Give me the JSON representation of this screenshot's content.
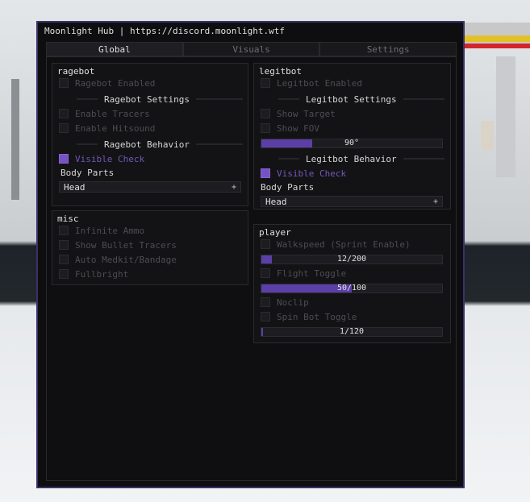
{
  "window": {
    "title": "Moonlight Hub | https://discord.moonlight.wtf"
  },
  "tabs": [
    "Global",
    "Visuals",
    "Settings"
  ],
  "ragebot": {
    "title": "ragebot",
    "enabled_label": "Ragebot Enabled",
    "settings_header": "Ragebot Settings",
    "tracers_label": "Enable Tracers",
    "hitsound_label": "Enable Hitsound",
    "behavior_header": "Ragebot Behavior",
    "visible_check_label": "Visible Check",
    "visible_check_checked": true,
    "body_parts_label": "Body Parts",
    "body_parts_value": "Head",
    "dropdown_icon": "+"
  },
  "misc": {
    "title": "misc",
    "items": [
      {
        "label": "Infinite Ammo",
        "checked": false
      },
      {
        "label": "Show Bullet Tracers",
        "checked": false
      },
      {
        "label": "Auto Medkit/Bandage",
        "checked": false
      },
      {
        "label": "Fullbright",
        "checked": false
      }
    ]
  },
  "legitbot": {
    "title": "legitbot",
    "enabled_label": "Legitbot Enabled",
    "settings_header": "Legitbot Settings",
    "show_target_label": "Show Target",
    "show_fov_label": "Show FOV",
    "fov_value": "90°",
    "fov_fraction": 0.28,
    "behavior_header": "Legitbot Behavior",
    "visible_check_label": "Visible Check",
    "visible_check_checked": true,
    "body_parts_label": "Body Parts",
    "body_parts_value": "Head",
    "dropdown_icon": "+"
  },
  "player": {
    "title": "player",
    "walkspeed_label": "Walkspeed (Sprint Enable)",
    "walkspeed_value": "12/200",
    "walkspeed_fraction": 0.06,
    "flight_label": "Flight Toggle",
    "flight_value": "50/100",
    "flight_fraction": 0.5,
    "noclip_label": "Noclip",
    "spinbot_label": "Spin Bot Toggle",
    "spinbot_value": "1/120",
    "spinbot_fraction": 0.01
  },
  "colors": {
    "accent": "#7553c2",
    "window_border": "#3c3166",
    "background": "#0e0e10"
  }
}
